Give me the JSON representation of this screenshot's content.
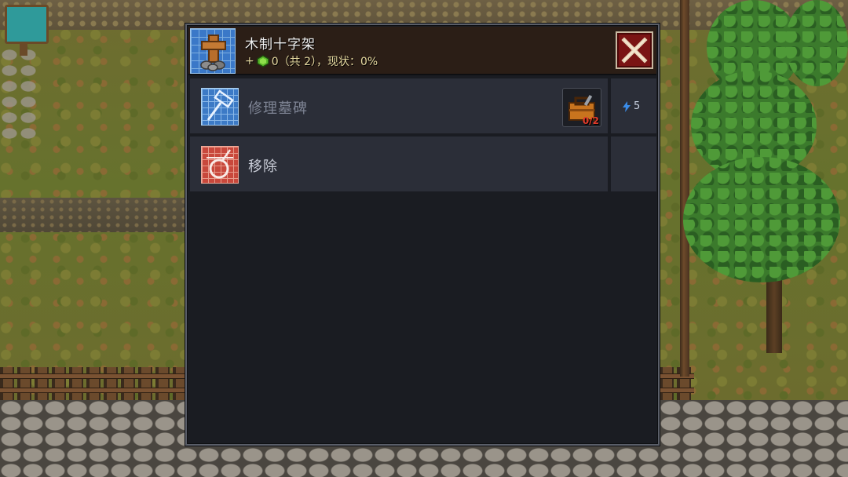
{
  "dialog": {
    "title": "木制十字架",
    "subtitle_prefix": "+",
    "subtitle_value": "0（共 2），现状：0%",
    "header_icon": "wooden-cross-blueprint-icon",
    "close_icon": "close-x-icon"
  },
  "actions": [
    {
      "label": "修理墓碑",
      "icon": "hammer-blueprint-icon",
      "enabled": false,
      "resource_icon": "toolbox-icon",
      "resource_count": "0/2",
      "energy_cost": "5",
      "energy_icon": "lightning-icon"
    },
    {
      "label": "移除",
      "icon": "wrecking-ball-icon",
      "enabled": true
    }
  ],
  "colors": {
    "panel_bg": "#1a1c22",
    "row_bg": "#2b2e38",
    "close_red": "#7a1414",
    "blueprint_blue": "#3c7ac6",
    "remove_red": "#c8483c",
    "resource_missing": "#e03a2a"
  }
}
